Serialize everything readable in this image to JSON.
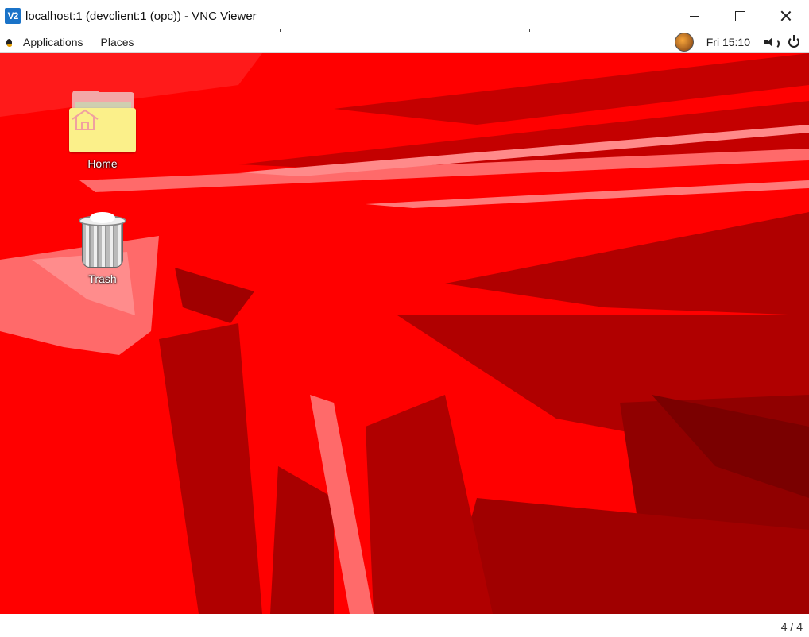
{
  "window": {
    "logo_text": "V2",
    "title": "localhost:1 (devclient:1 (opc)) - VNC Viewer"
  },
  "topbar": {
    "menus": [
      "Applications",
      "Places"
    ],
    "clock": "Fri 15:10"
  },
  "desktop": {
    "icons": [
      {
        "label": "Home",
        "icon": "home-folder-icon"
      },
      {
        "label": "Trash",
        "icon": "trash-icon"
      }
    ]
  },
  "status": {
    "page_count": "4 / 4"
  },
  "colors": {
    "wallpaper_base": "#ff0000",
    "wallpaper_dark": "#b00000",
    "wallpaper_light": "#ff6a6a"
  }
}
